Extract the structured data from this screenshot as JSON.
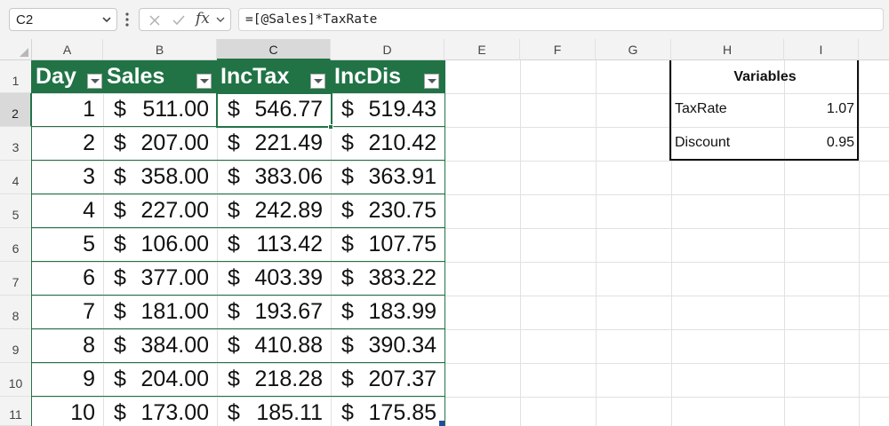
{
  "formula_bar": {
    "name_box": "C2",
    "fx_label": "fx",
    "formula": "=[@Sales]*TaxRate"
  },
  "columns": [
    "A",
    "B",
    "C",
    "D",
    "E",
    "F",
    "G",
    "H",
    "I"
  ],
  "rows": [
    "1",
    "2",
    "3",
    "4",
    "5",
    "6",
    "7",
    "8",
    "9",
    "10",
    "11"
  ],
  "table": {
    "headers": [
      "Day",
      "Sales",
      "IncTax",
      "IncDis"
    ],
    "rows": [
      {
        "day": "1",
        "sales": "511.00",
        "inctax": "546.77",
        "incdis": "519.43"
      },
      {
        "day": "2",
        "sales": "207.00",
        "inctax": "221.49",
        "incdis": "210.42"
      },
      {
        "day": "3",
        "sales": "358.00",
        "inctax": "383.06",
        "incdis": "363.91"
      },
      {
        "day": "4",
        "sales": "227.00",
        "inctax": "242.89",
        "incdis": "230.75"
      },
      {
        "day": "5",
        "sales": "106.00",
        "inctax": "113.42",
        "incdis": "107.75"
      },
      {
        "day": "6",
        "sales": "377.00",
        "inctax": "403.39",
        "incdis": "383.22"
      },
      {
        "day": "7",
        "sales": "181.00",
        "inctax": "193.67",
        "incdis": "183.99"
      },
      {
        "day": "8",
        "sales": "384.00",
        "inctax": "410.88",
        "incdis": "390.34"
      },
      {
        "day": "9",
        "sales": "204.00",
        "inctax": "218.28",
        "incdis": "207.37"
      },
      {
        "day": "10",
        "sales": "173.00",
        "inctax": "185.11",
        "incdis": "175.85"
      }
    ],
    "currency_symbol": "$"
  },
  "variables": {
    "title": "Variables",
    "items": [
      {
        "name": "TaxRate",
        "value": "1.07"
      },
      {
        "name": "Discount",
        "value": "0.95"
      }
    ]
  },
  "colors": {
    "table_header": "#217346",
    "selection": "#217346"
  }
}
